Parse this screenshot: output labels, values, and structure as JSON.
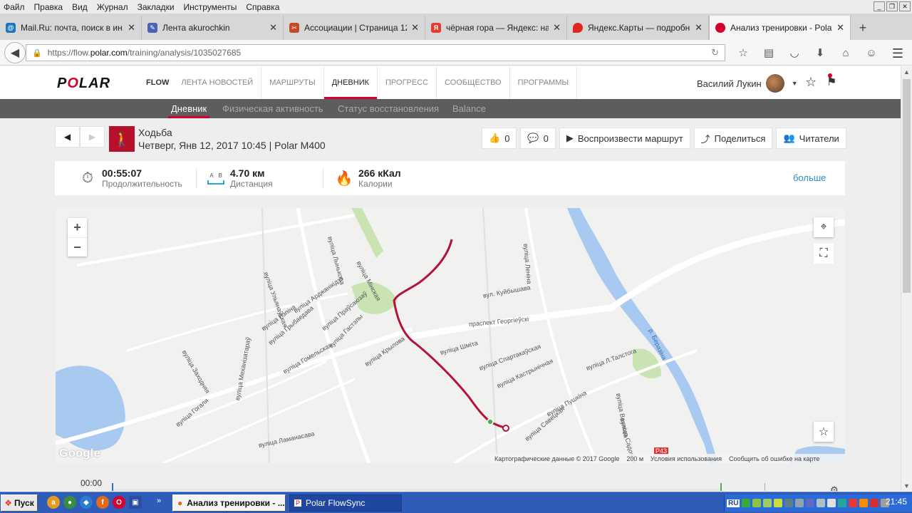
{
  "firefox": {
    "menu": [
      "Файл",
      "Правка",
      "Вид",
      "Журнал",
      "Закладки",
      "Инструменты",
      "Справка"
    ],
    "tabs": [
      {
        "title": "Mail.Ru: почта, поиск в ин...",
        "icon": "mailru-icon",
        "color": "#1c74c4"
      },
      {
        "title": "Лента akurochkin",
        "icon": "lj-icon",
        "color": "#4b63b6"
      },
      {
        "title": "Ассоциации | Страница 12...",
        "icon": "assoc-icon",
        "color": "#c44b2a"
      },
      {
        "title": "чёрная гора — Яндекс: на...",
        "icon": "yandex-icon",
        "color": "#e63b2e"
      },
      {
        "title": "Яндекс.Карты — подробн...",
        "icon": "yandex-maps-icon",
        "color": "#e0271e"
      },
      {
        "title": "Анализ тренировки - Polar...",
        "icon": "polar-icon",
        "color": "#d4002f"
      }
    ],
    "url": {
      "host_prefix": "https://flow.",
      "host": "polar.com",
      "path": "/training/analysis/1035027685"
    }
  },
  "polar": {
    "logo": {
      "before": "P",
      "o": "O",
      "after": "LAR"
    },
    "nav": [
      "FLOW",
      "ЛЕНТА НОВОСТЕЙ",
      "МАРШРУТЫ",
      "ДНЕВНИК",
      "ПРОГРЕСС",
      "СООБЩЕСТВО",
      "ПРОГРАММЫ"
    ],
    "nav_active": "ДНЕВНИК",
    "user": "Василий Лукин",
    "subnav": [
      "Дневник",
      "Физическая активность",
      "Статус восстановления",
      "Balance"
    ],
    "subnav_active": "Дневник",
    "activity": {
      "title": "Ходьба",
      "date": "Четверг, Янв 12, 2017 10:45 | Polar M400"
    },
    "buttons": {
      "likes": "0",
      "comments": "0",
      "replay": "Воспроизвести маршрут",
      "share": "Поделиться",
      "readers": "Читатели"
    },
    "summary": {
      "duration_value": "00:55:07",
      "duration_label": "Продолжительность",
      "distance_value": "4.70 км",
      "distance_label": "Дистанция",
      "distance_a": "A",
      "distance_b": "B",
      "calories_value": "266 кКал",
      "calories_label": "Калории",
      "more": "больше"
    },
    "map": {
      "attribution": "Картографические данные © 2017 Google",
      "scale": "200 м",
      "terms": "Условия использования",
      "report": "Сообщить об ошибке на карте",
      "google": "Google",
      "labels": [
        "вуліца Мінская",
        "вул. Куйбышава",
        "праспект Георгіеўскі",
        "вуліца Леніна",
        "р. Беразіна",
        "вуліца Шміта",
        "вуліца Спартакаўская",
        "вуліца Кастрынічная",
        "вуліца Пушкіна",
        "вуліца Л.Талстога",
        "вуліца Ваякова",
        "вуліца Садовая",
        "вуліца Крылова",
        "вуліца Гастэлы",
        "вуліца Праўсаюзаў",
        "вуліца Гомельская",
        "вуліца Грыбаедава",
        "вуліца Рэпіна",
        "вуліца Арджанікідзэ",
        "вуліца Заходняя",
        "вуліца Гогаля",
        "вуліца Ламанасава",
        "вуліца Механізатараў",
        "вуліца Савецкая",
        "вуліца Лынькова",
        "вуліца Ульянаўская",
        "Р43"
      ]
    },
    "timeline": {
      "start": "00:00"
    }
  },
  "taskbar": {
    "start": "Пуск",
    "tasks": [
      "Анализ тренировки - ...",
      "Polar FlowSync"
    ],
    "lang": "RU",
    "clock": "21:45"
  }
}
